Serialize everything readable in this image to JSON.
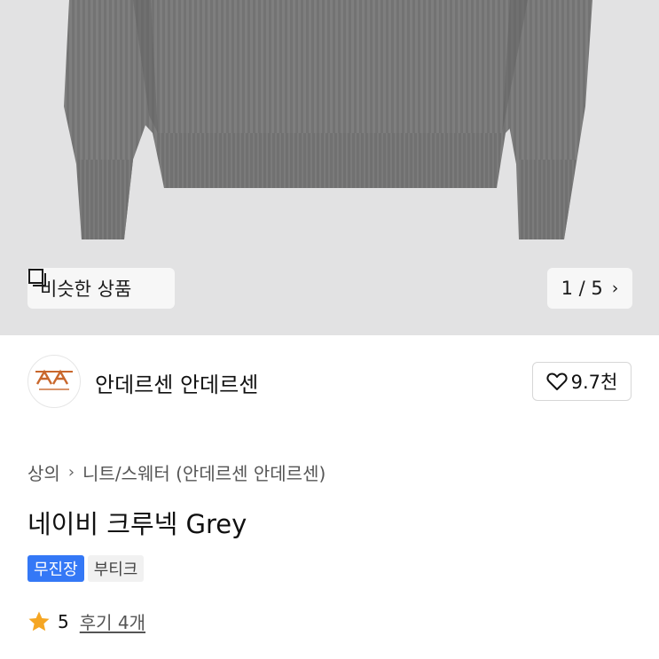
{
  "gallery": {
    "similar_label": "비슷한 상품",
    "similar_icon": "similar-items-icon",
    "counter": "1 / 5",
    "next_icon": "chevron-right-icon"
  },
  "seller": {
    "name": "안데르센 안데르센",
    "logo_text": "ANDERSEN-ANDERSEN",
    "like_count": "9.7천",
    "like_icon": "heart-outline-icon"
  },
  "product": {
    "breadcrumb": [
      "상의",
      "니트/스웨터 (안데르센 안데르센)"
    ],
    "breadcrumb_separator_icon": "chevron-right-icon",
    "title": "네이비 크루넥 Grey",
    "badges": [
      "무진장",
      "부티크"
    ],
    "rating": "5",
    "reviews": "후기 4개",
    "star_color": "#f5a623"
  },
  "colors": {
    "badge_blue": "#3478f6",
    "logo_orange": "#c9672c"
  }
}
